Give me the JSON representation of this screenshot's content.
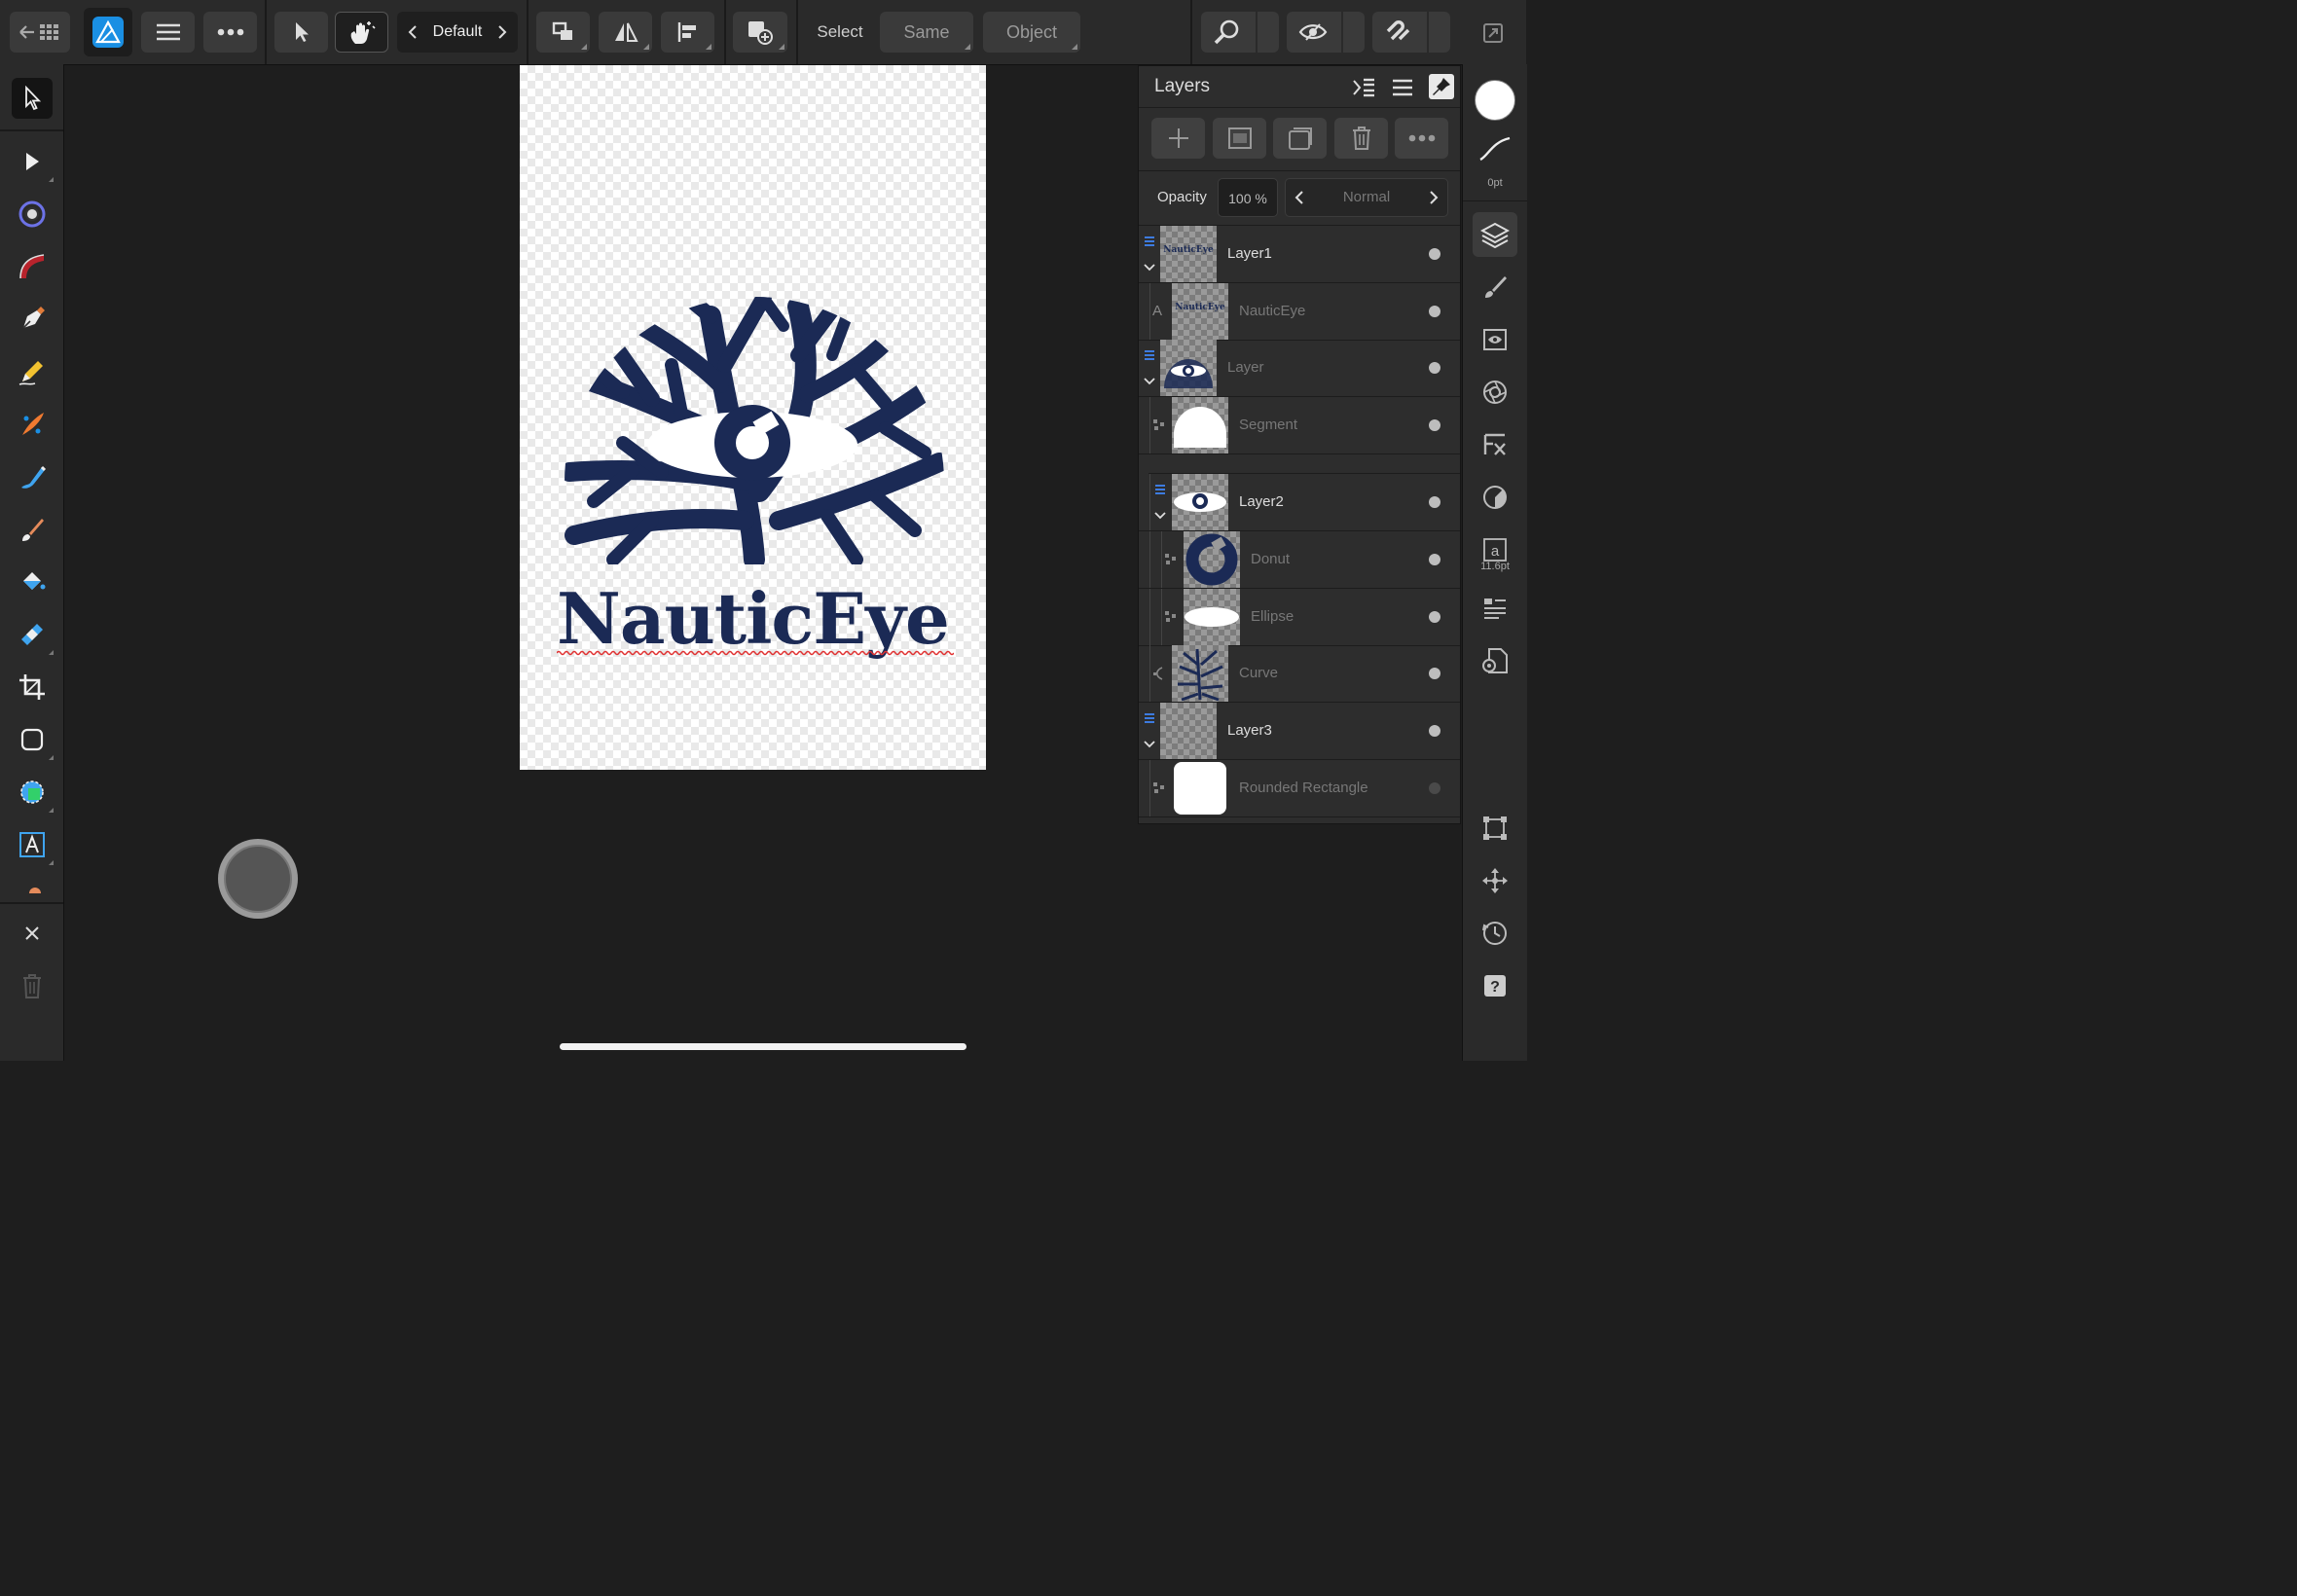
{
  "toolbar": {
    "preset_label": "Default",
    "select_label": "Select",
    "same_label": "Same",
    "object_label": "Object"
  },
  "document": {
    "logo_text": "NauticEye",
    "colors": {
      "navy": "#1b2a55",
      "accent_blue": "#1a8fe3",
      "spell_red": "#e03030"
    }
  },
  "layers_panel": {
    "title": "Layers",
    "opacity_label": "Opacity",
    "opacity_value": "100 %",
    "blend_mode": "Normal",
    "rows": [
      {
        "name": "Layer1",
        "kind": "layer",
        "icon": "layer-stack-icon"
      },
      {
        "name": "NauticEye",
        "kind": "text",
        "icon": "text-layer-icon"
      },
      {
        "name": "Layer",
        "kind": "layer",
        "icon": "layer-stack-icon"
      },
      {
        "name": "Segment",
        "kind": "shape",
        "icon": "shape-icon"
      },
      {
        "name": "Layer2",
        "kind": "layer",
        "icon": "layer-stack-icon"
      },
      {
        "name": "Donut",
        "kind": "shape",
        "icon": "shape-icon"
      },
      {
        "name": "Ellipse",
        "kind": "shape",
        "icon": "shape-icon"
      },
      {
        "name": "Curve",
        "kind": "curve",
        "icon": "curve-icon"
      },
      {
        "name": "Layer3",
        "kind": "layer",
        "icon": "layer-stack-icon"
      },
      {
        "name": "Rounded Rectangle",
        "kind": "shape",
        "icon": "shape-icon"
      }
    ]
  },
  "studio": {
    "stroke_width": "0pt",
    "font_size": "11.6pt"
  }
}
